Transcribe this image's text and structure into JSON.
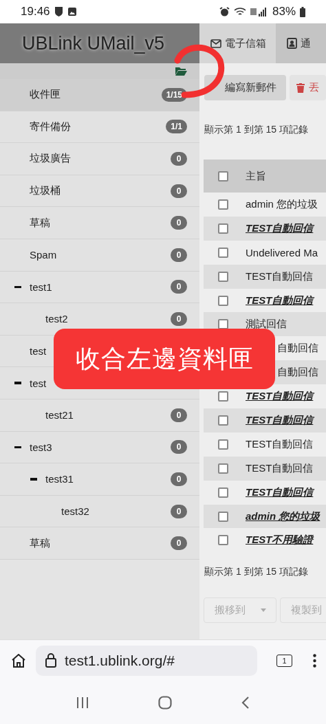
{
  "status_bar": {
    "time": "19:46",
    "battery": "83%"
  },
  "sidebar": {
    "title": "UBLink UMail_v5",
    "folders": [
      {
        "name": "收件匣",
        "count": "1/15",
        "selected": true
      },
      {
        "name": "寄件備份",
        "count": "1/1",
        "selected": false
      },
      {
        "name": "垃圾廣告",
        "count": "0",
        "selected": false
      },
      {
        "name": "垃圾桶",
        "count": "0",
        "selected": false
      },
      {
        "name": "草稿",
        "count": "0",
        "selected": false
      },
      {
        "name": "Spam",
        "count": "0",
        "selected": false
      },
      {
        "name": "test1",
        "count": "0",
        "selected": false,
        "expanded": true,
        "children": [
          {
            "name": "test2",
            "count": "0",
            "selected": false
          }
        ]
      },
      {
        "name": "test",
        "selected": false
      },
      {
        "name": "test",
        "selected": false,
        "expanded": true,
        "children": [
          {
            "name": "test21",
            "count": "0",
            "selected": false
          }
        ]
      },
      {
        "name": "test3",
        "count": "0",
        "selected": false,
        "expanded": true,
        "children": [
          {
            "name": "test31",
            "count": "0",
            "selected": false,
            "expanded": true,
            "children": [
              {
                "name": "test32",
                "count": "0",
                "selected": false
              }
            ]
          }
        ]
      },
      {
        "name": "草稿",
        "count": "0",
        "selected": false
      }
    ]
  },
  "tabs": [
    {
      "label": "電子信箱",
      "selected": true
    },
    {
      "label": "通",
      "selected": false
    }
  ],
  "toolbar": [
    {
      "label": "編寫新郵件",
      "kind": "compose"
    },
    {
      "label": "丟",
      "kind": "delete"
    }
  ],
  "records_top": "顯示第 1 到第 15 項記錄",
  "table": {
    "header": {
      "label": "主旨",
      "checked": false
    },
    "rows": [
      {
        "subject": "admin 您的垃圾",
        "unread": false,
        "checked": false
      },
      {
        "subject": "TEST自動回信",
        "unread": true,
        "checked": false
      },
      {
        "subject": "Undelivered Ma",
        "unread": false,
        "checked": false
      },
      {
        "subject": "TEST自動回信",
        "unread": false,
        "checked": false
      },
      {
        "subject": "TEST自動回信",
        "unread": true,
        "checked": false
      },
      {
        "subject": "測試回信",
        "unread": false,
        "checked": false
      },
      {
        "subject": "自動回信",
        "unread": false,
        "covered": true
      },
      {
        "subject": "自動回信",
        "unread": false,
        "covered": true
      },
      {
        "subject": "TEST自動回信",
        "unread": true,
        "checked": false
      },
      {
        "subject": "TEST自動回信",
        "unread": true,
        "checked": false
      },
      {
        "subject": "TEST自動回信",
        "unread": false,
        "checked": false
      },
      {
        "subject": "TEST自動回信",
        "unread": false,
        "checked": false
      },
      {
        "subject": "TEST自動回信",
        "unread": true,
        "checked": false
      },
      {
        "subject": "admin 您的垃圾",
        "unread": true,
        "checked": false
      },
      {
        "subject": "TEST不用驗證",
        "unread": true,
        "checked": false
      }
    ]
  },
  "records_bottom": "顯示第 1 到第 15 項記錄",
  "actions": [
    {
      "label": "搬移到",
      "kind": "dropdown",
      "disabled": true
    },
    {
      "label": "複製到",
      "kind": "button",
      "disabled": true
    }
  ],
  "browser": {
    "url": "test1.ublink.org/#",
    "tab_count": "1"
  },
  "annotation": {
    "callout": "收合左邊資料匣"
  }
}
